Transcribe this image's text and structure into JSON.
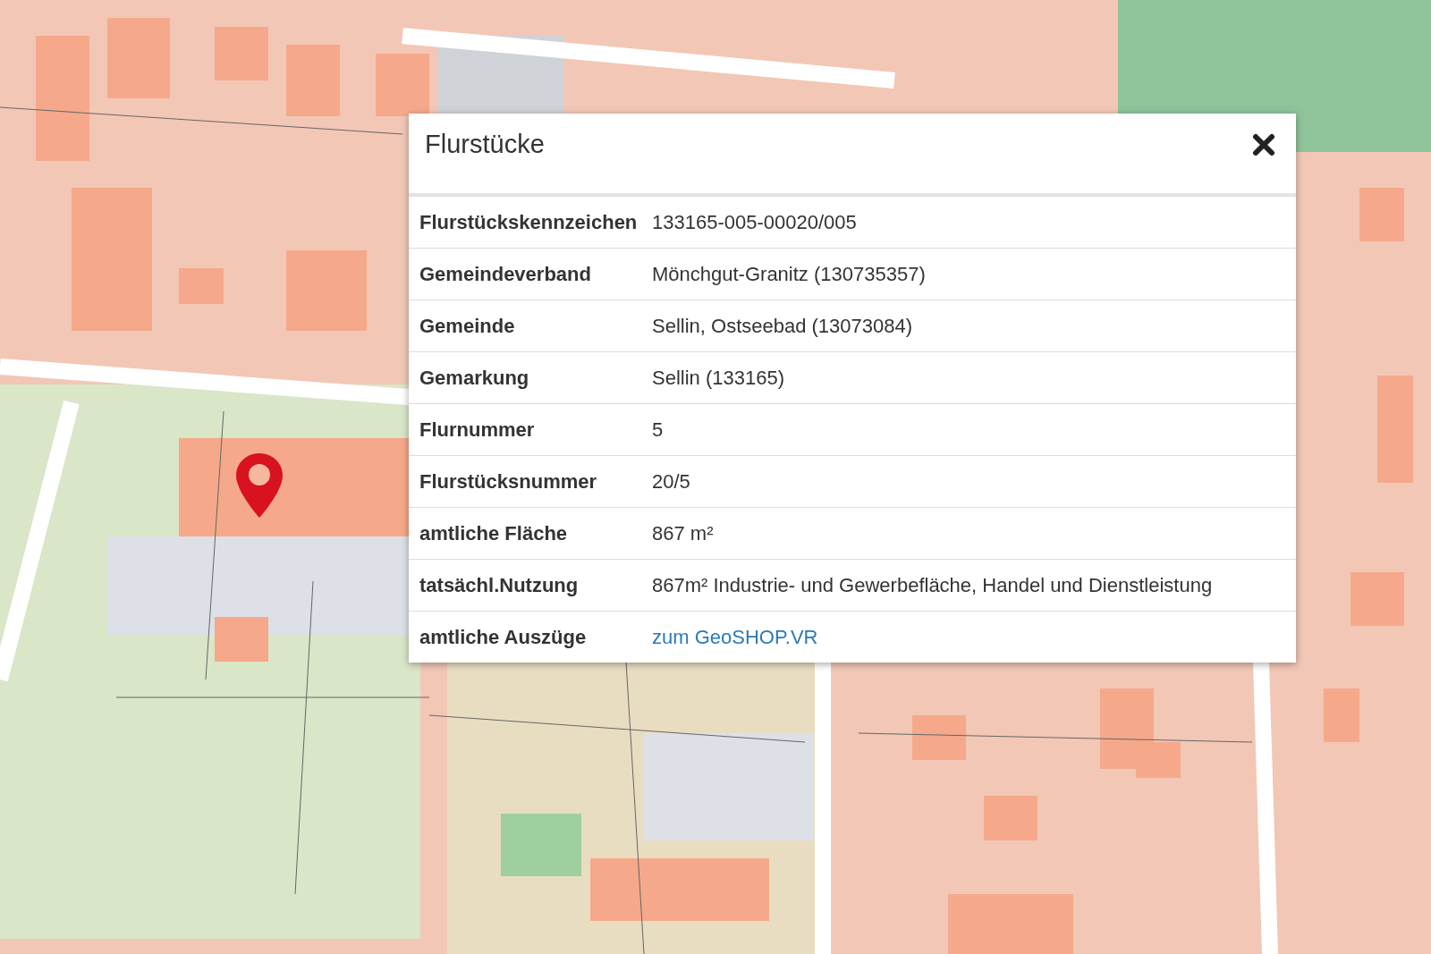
{
  "popup": {
    "title": "Flurstücke",
    "rows": [
      {
        "label": "Flurstückskennzeichen",
        "value": "133165-005-00020/005",
        "kind": "text"
      },
      {
        "label": "Gemeindeverband",
        "value": "Mönchgut-Granitz (130735357)",
        "kind": "text"
      },
      {
        "label": "Gemeinde",
        "value": "Sellin, Ostseebad (13073084)",
        "kind": "text"
      },
      {
        "label": "Gemarkung",
        "value": "Sellin (133165)",
        "kind": "text"
      },
      {
        "label": "Flurnummer",
        "value": "5",
        "kind": "text"
      },
      {
        "label": "Flurstücksnummer",
        "value": "20/5",
        "kind": "text"
      },
      {
        "label": "amtliche Fläche",
        "value": "867 m²",
        "kind": "text"
      },
      {
        "label": "tatsächl.Nutzung",
        "value": "867m² Industrie- und Gewerbefläche, Handel und Dienstleistung",
        "kind": "text"
      },
      {
        "label": "amtliche Auszüge",
        "value": "zum GeoSHOP.VR",
        "kind": "link"
      }
    ]
  }
}
